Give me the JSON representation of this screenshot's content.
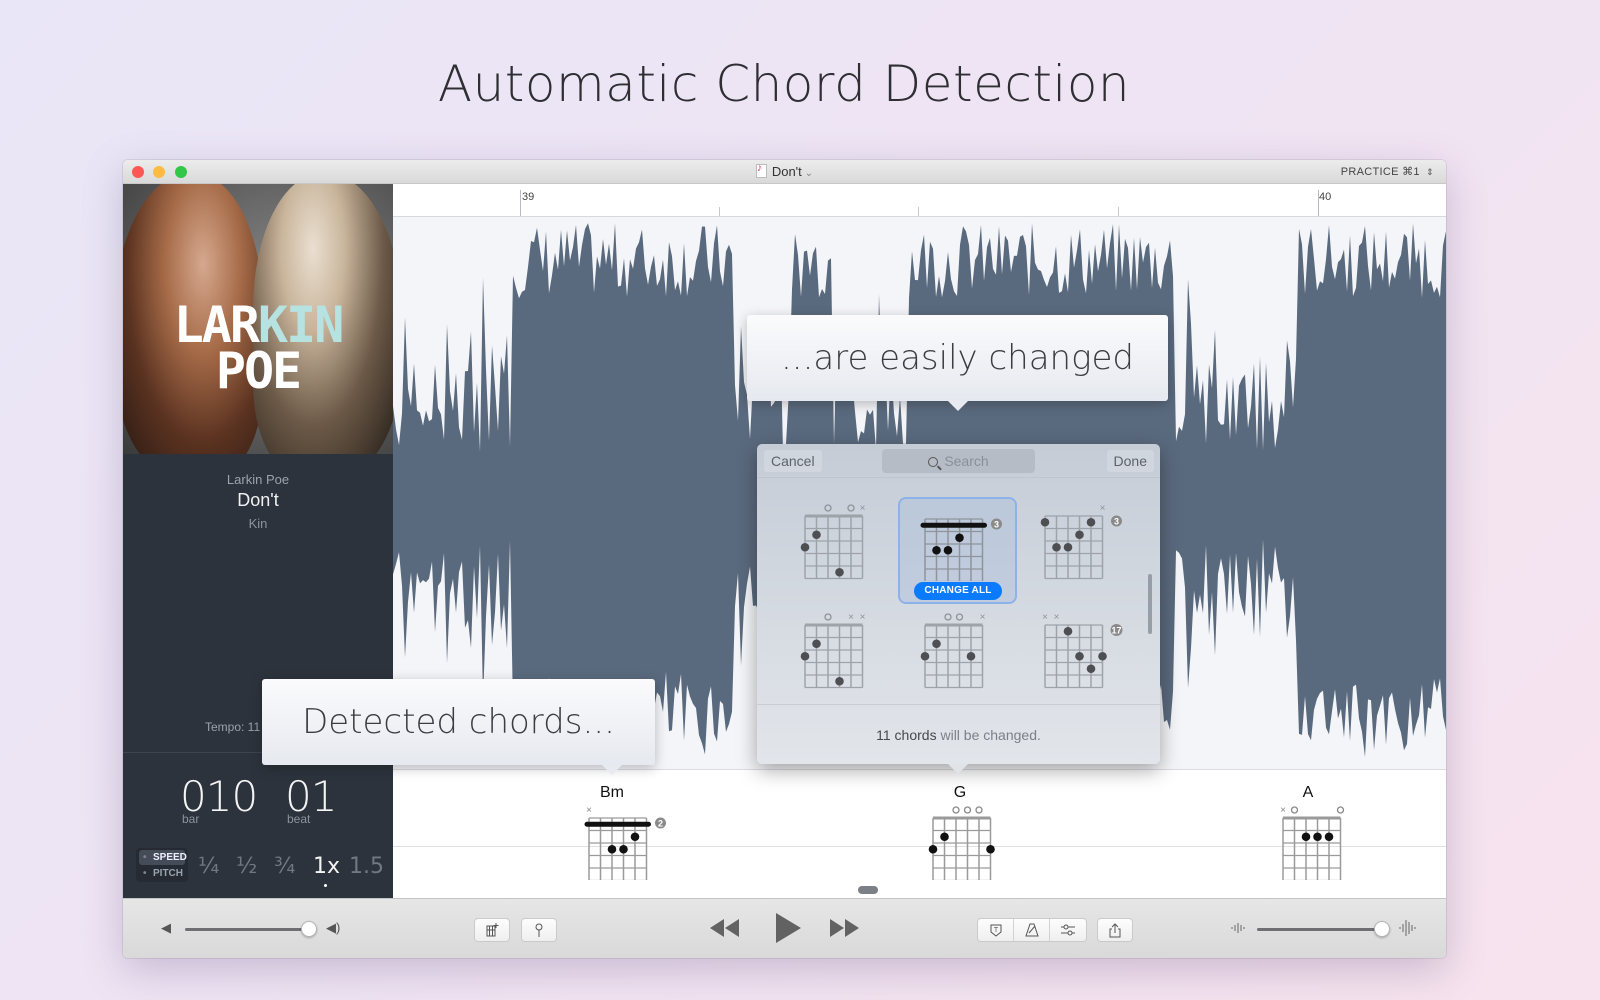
{
  "headline": "Automatic Chord Detection",
  "window": {
    "title": "Don't",
    "mode": "PRACTICE",
    "mode_shortcut": "⌘1"
  },
  "sidebar": {
    "cover": {
      "line1_a": "LAR",
      "line1_b": "KIN",
      "line2": "POE",
      "accent": "#b6e2e2"
    },
    "artist": "Larkin Poe",
    "title": "Don't",
    "album": "Kin",
    "tempo": "Tempo: 11",
    "bar_value": "010",
    "bar_label": "bar",
    "beat_value": "01",
    "beat_label": "beat",
    "mode_options": [
      "SPEED",
      "PITCH"
    ],
    "mode_selected": "SPEED",
    "rates": [
      "¼",
      "½",
      "¾",
      "1x",
      "1.5"
    ],
    "rate_selected": "1x"
  },
  "ruler": {
    "markers": [
      "39",
      "40"
    ]
  },
  "callouts": {
    "top": "...are easily changed",
    "bottom": "Detected chords..."
  },
  "popover": {
    "cancel": "Cancel",
    "search_placeholder": "Search",
    "done": "Done",
    "change_all": "CHANGE ALL",
    "footer_count": "11 chords",
    "footer_rest": " will be changed.",
    "options": [
      {
        "top": "  O OX",
        "fret": ""
      },
      {
        "top": "",
        "fret": "3",
        "selected": true
      },
      {
        "top": "     X",
        "fret": "3"
      },
      {
        "top": "  O XX",
        "fret": ""
      },
      {
        "top": "   OO X",
        "fret": ""
      },
      {
        "top": "XX",
        "fret": "17"
      }
    ]
  },
  "chord_lane": {
    "chords": [
      {
        "name": "Bm",
        "top": "X",
        "fret": "2"
      },
      {
        "name": "G",
        "top": "OOO",
        "fret": ""
      },
      {
        "name": "A",
        "top": "XO   O",
        "fret": ""
      }
    ]
  },
  "toolbar": {
    "volume_level": 1.0,
    "waveform_zoom_level": 0.98,
    "buttons": [
      "add-chord",
      "marker",
      "tuner",
      "metronome",
      "mixer",
      "share"
    ]
  },
  "colors": {
    "waveform": "#5a6a7e",
    "accent_blue": "#0a7bff"
  }
}
